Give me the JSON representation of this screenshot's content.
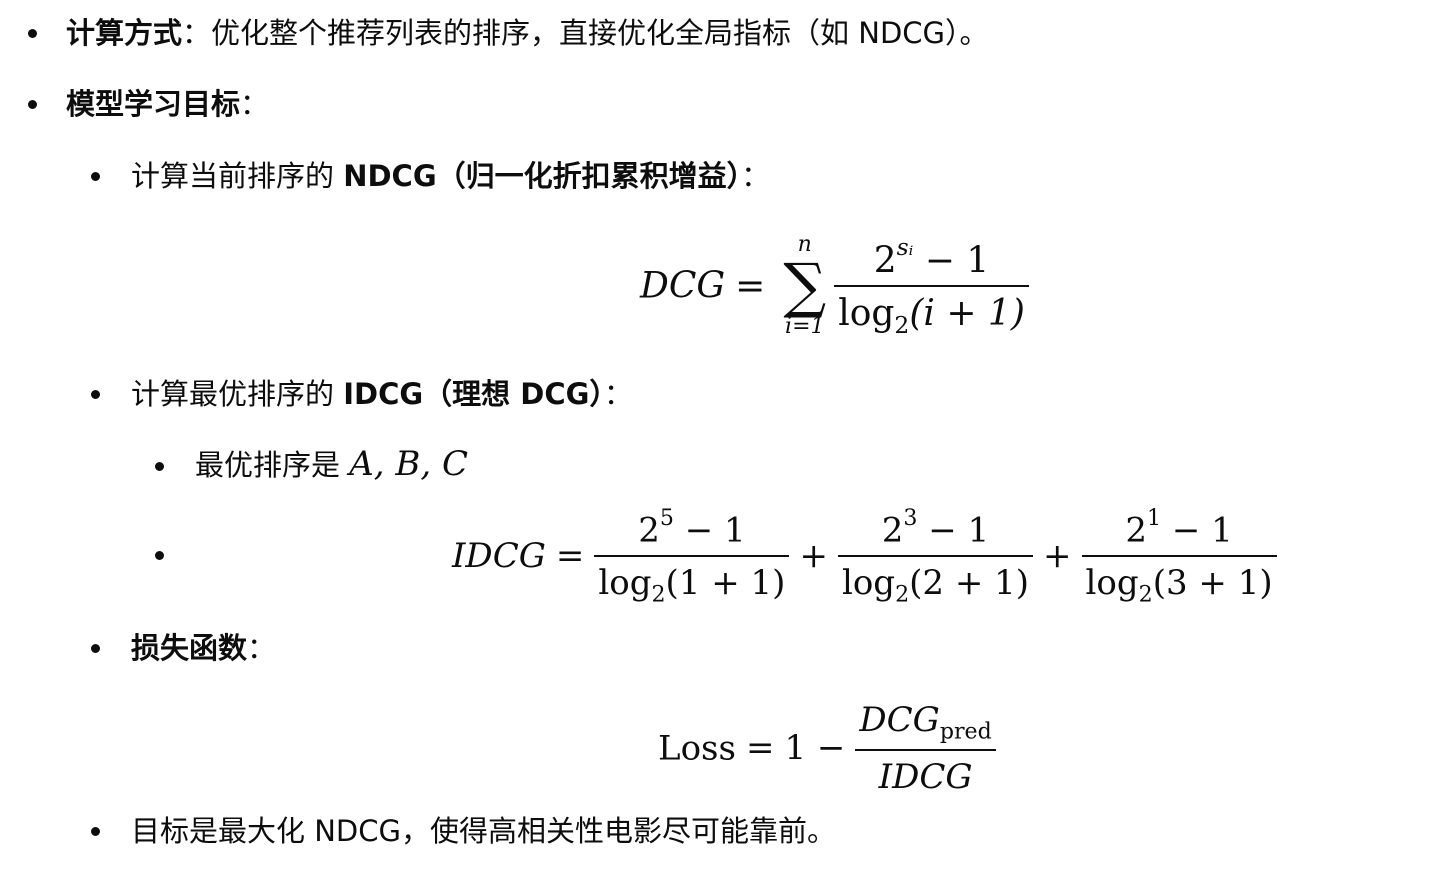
{
  "items": {
    "calc_method": {
      "label": "计算方式",
      "sep": "：",
      "text": "优化整个推荐列表的排序，直接优化全局指标（如 NDCG）。"
    },
    "model_goal": {
      "label": "模型学习目标",
      "sep": "："
    },
    "ndcg_step": {
      "prefix": "计算当前排序的 ",
      "label": "NDCG（归一化折扣累积增益）",
      "sep": "："
    },
    "idcg_step": {
      "prefix": "计算最优排序的 ",
      "label": "IDCG（理想 DCG）",
      "sep": "："
    },
    "optimal_order": {
      "text": "最优排序是 ",
      "math": "A, B, C"
    },
    "loss_step": {
      "label": "损失函数",
      "sep": "："
    },
    "objective": {
      "text": "目标是最大化 NDCG，使得高相关性电影尽可能靠前。"
    }
  },
  "formulas": {
    "dcg": {
      "lhs": "DCG",
      "eq": "=",
      "sum_upper": "n",
      "sum_lower": "i=1",
      "sum_symbol": "∑",
      "num_base": "2",
      "num_exp": "sᵢ",
      "num_tail": " − 1",
      "den_log": "log",
      "den_base": "2",
      "den_arg": "(i + 1)"
    },
    "idcg": {
      "lhs": "IDCG",
      "eq": "=",
      "plus": "+",
      "terms": [
        {
          "base": "2",
          "exp": "5",
          "tail": " − 1",
          "log": "log",
          "log_base": "2",
          "arg": "(1 + 1)"
        },
        {
          "base": "2",
          "exp": "3",
          "tail": " − 1",
          "log": "log",
          "log_base": "2",
          "arg": "(2 + 1)"
        },
        {
          "base": "2",
          "exp": "1",
          "tail": " − 1",
          "log": "log",
          "log_base": "2",
          "arg": "(3 + 1)"
        }
      ]
    },
    "loss": {
      "lhs": "Loss",
      "eq": "=",
      "one_minus": "1 −",
      "num": "DCG",
      "num_sub": "pred",
      "den": "IDCG"
    }
  }
}
